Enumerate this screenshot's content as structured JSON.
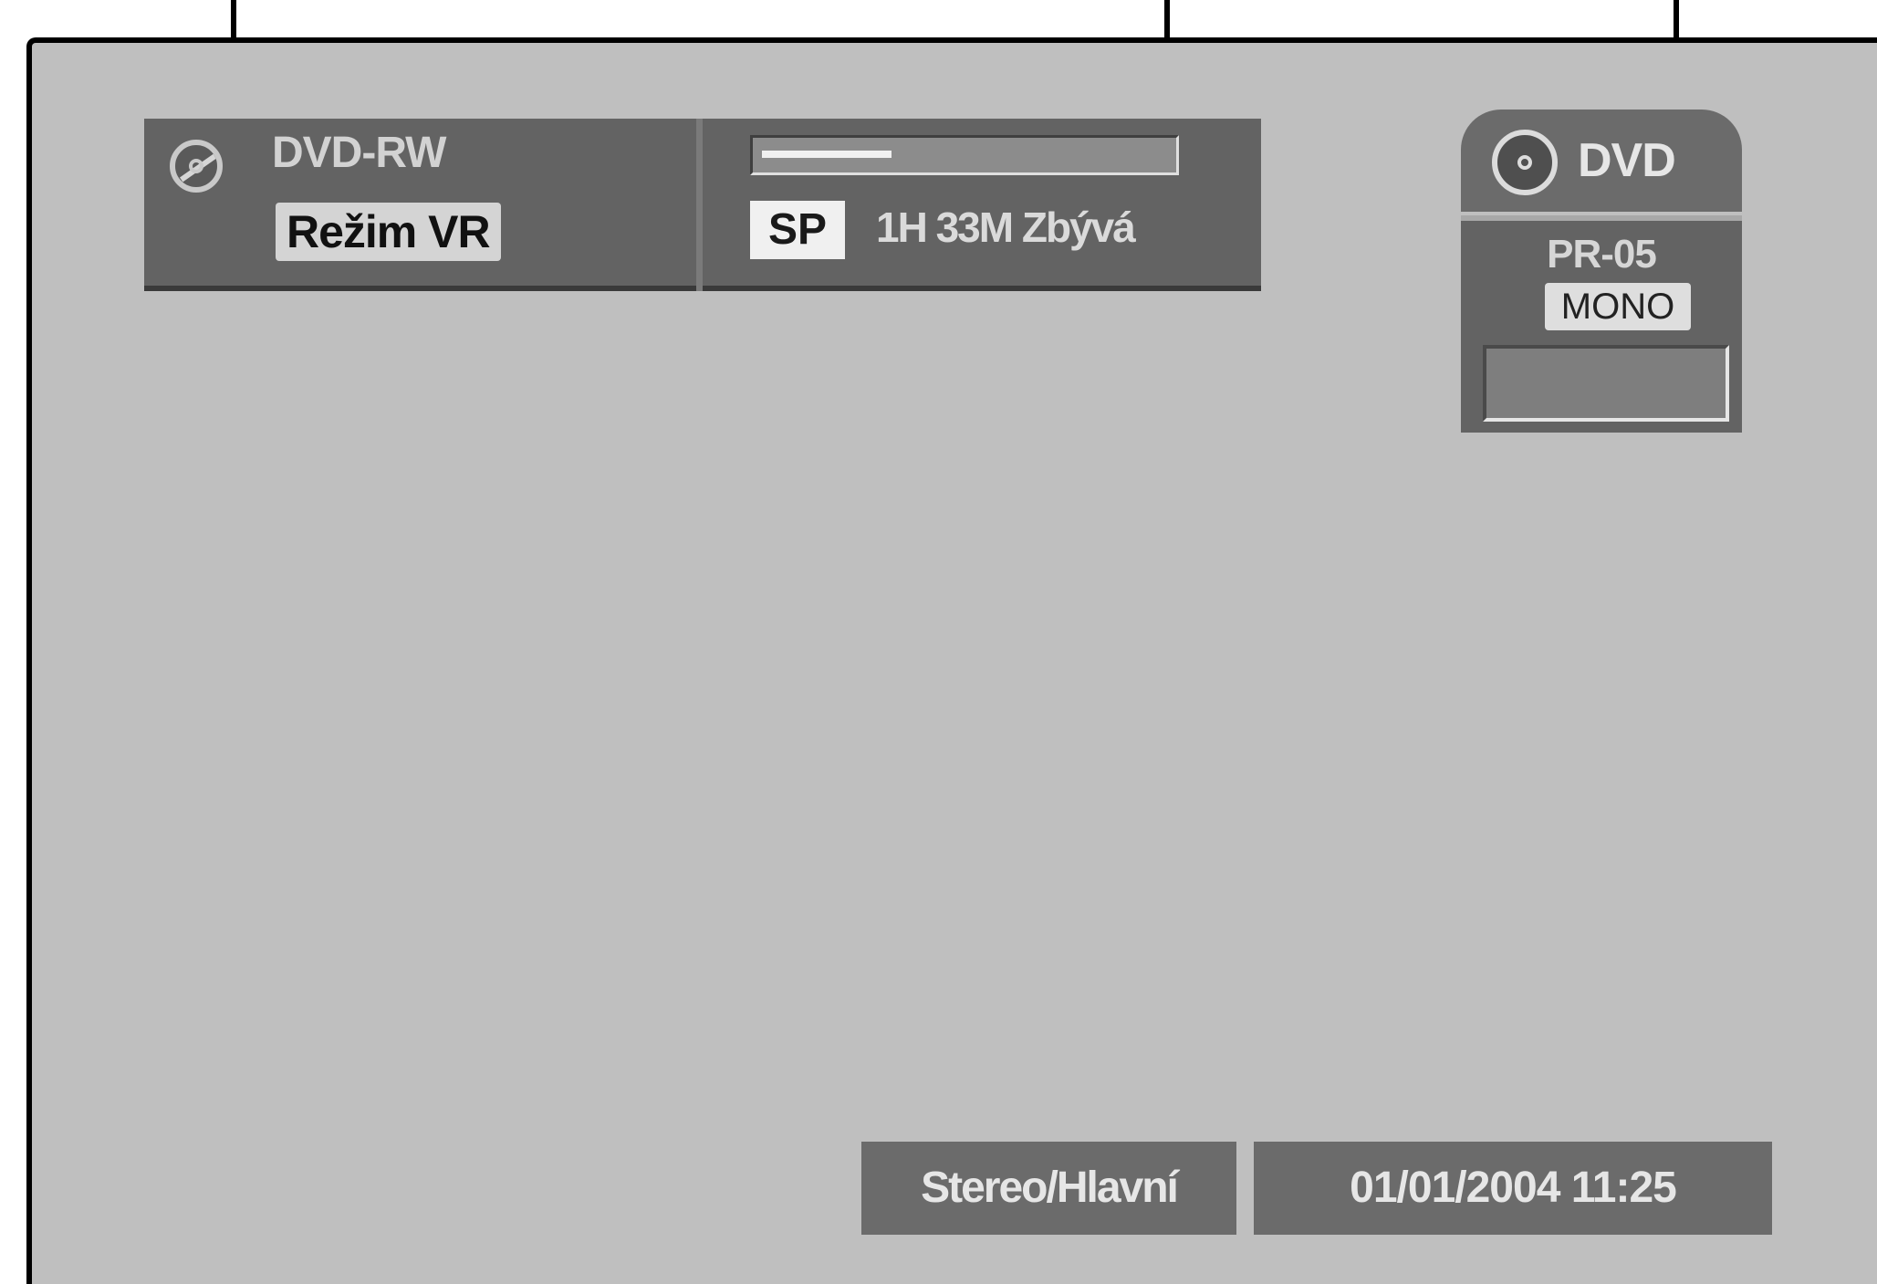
{
  "disc_info": {
    "disc_type": "DVD-RW",
    "mode": "Režim VR"
  },
  "recording": {
    "progress_fraction": 0.32,
    "quality": "SP",
    "remaining": "1H 33M Zbývá"
  },
  "source": {
    "label": "DVD",
    "channel": "PR-05",
    "audio": "MONO"
  },
  "status": {
    "audio_output": "Stereo/Hlavní",
    "datetime": "01/01/2004 11:25"
  },
  "icons": {
    "disc": "disc-icon",
    "source_disc": "dvd-disc-icon"
  }
}
